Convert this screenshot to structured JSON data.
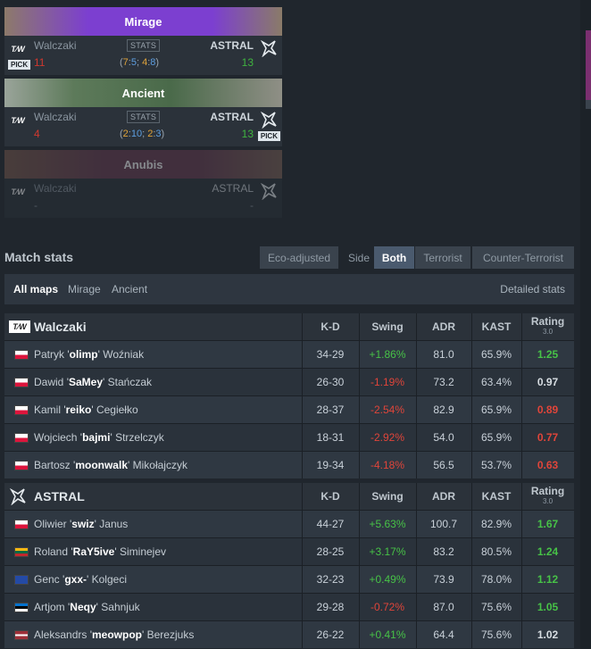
{
  "maps": [
    {
      "name": "Mirage",
      "team_left": "Walczaki",
      "team_right": "ASTRAL",
      "score_left": "11",
      "score_right": "13",
      "stats_label": "STATS",
      "half_open": "(",
      "half_t1": "7",
      "half_sep1": ":",
      "half_ct1": "5",
      "half_semi": "; ",
      "half_t2": "4",
      "half_sep2": ":",
      "half_ct2": "8",
      "half_close": ")",
      "pick_label": "PICK",
      "pick_side": "left",
      "banner_color": "#7c3fd0"
    },
    {
      "name": "Ancient",
      "team_left": "Walczaki",
      "team_right": "ASTRAL",
      "score_left": "4",
      "score_right": "13",
      "stats_label": "STATS",
      "half_open": "(",
      "half_t1": "2",
      "half_sep1": ":",
      "half_ct1": "10",
      "half_semi": "; ",
      "half_t2": "2",
      "half_sep2": ":",
      "half_ct2": "3",
      "half_close": ")",
      "pick_label": "PICK",
      "pick_side": "right",
      "banner_color": "#4f6a4e"
    },
    {
      "name": "Anubis",
      "team_left": "Walczaki",
      "team_right": "ASTRAL",
      "score_left": "-",
      "score_right": "-",
      "banner_color": "#5a3e48"
    }
  ],
  "match_stats": {
    "title": "Match stats",
    "eco_label": "Eco-adjusted",
    "side_label": "Side",
    "side_options": [
      "Both",
      "Terrorist",
      "Counter-Terrorist"
    ],
    "side_selected": "Both",
    "map_filters": [
      "All maps",
      "Mirage",
      "Ancient"
    ],
    "map_selected": "All maps",
    "detailed_label": "Detailed stats"
  },
  "columns": {
    "kd": "K-D",
    "swing": "Swing",
    "adr": "ADR",
    "kast": "KAST",
    "rating": "Rating",
    "rating_ver": "3.0"
  },
  "teams": [
    {
      "name": "Walczaki",
      "players": [
        {
          "first": "Patryk",
          "nick": "olimp",
          "last": "Woźniak",
          "flag": "pl",
          "kd": "34-29",
          "swing": "+1.86%",
          "adr": "81.0",
          "kast": "65.9%",
          "rating": "1.25"
        },
        {
          "first": "Dawid",
          "nick": "SaMey",
          "last": "Stańczak",
          "flag": "pl",
          "kd": "26-30",
          "swing": "-1.19%",
          "adr": "73.2",
          "kast": "63.4%",
          "rating": "0.97"
        },
        {
          "first": "Kamil",
          "nick": "reiko",
          "last": "Cegiełko",
          "flag": "pl",
          "kd": "28-37",
          "swing": "-2.54%",
          "adr": "82.9",
          "kast": "65.9%",
          "rating": "0.89"
        },
        {
          "first": "Wojciech",
          "nick": "bajmi",
          "last": "Strzelczyk",
          "flag": "pl",
          "kd": "18-31",
          "swing": "-2.92%",
          "adr": "54.0",
          "kast": "65.9%",
          "rating": "0.77"
        },
        {
          "first": "Bartosz",
          "nick": "moonwalk",
          "last": "Mikołajczyk",
          "flag": "pl",
          "kd": "19-34",
          "swing": "-4.18%",
          "adr": "56.5",
          "kast": "53.7%",
          "rating": "0.63"
        }
      ]
    },
    {
      "name": "ASTRAL",
      "players": [
        {
          "first": "Oliwier",
          "nick": "swiz",
          "last": "Janus",
          "flag": "pl",
          "kd": "44-27",
          "swing": "+5.63%",
          "adr": "100.7",
          "kast": "82.9%",
          "rating": "1.67"
        },
        {
          "first": "Roland",
          "nick": "RaY5ive",
          "last": "Siminejev",
          "flag": "lt",
          "kd": "28-25",
          "swing": "+3.17%",
          "adr": "83.2",
          "kast": "80.5%",
          "rating": "1.24"
        },
        {
          "first": "Genc",
          "nick": "gxx-",
          "last": "Kolgeci",
          "flag": "xk",
          "kd": "32-23",
          "swing": "+0.49%",
          "adr": "73.9",
          "kast": "78.0%",
          "rating": "1.12"
        },
        {
          "first": "Artjom",
          "nick": "Neqy",
          "last": "Sahnjuk",
          "flag": "ee",
          "kd": "29-28",
          "swing": "-0.72%",
          "adr": "87.0",
          "kast": "75.6%",
          "rating": "1.05"
        },
        {
          "first": "Aleksandrs",
          "nick": "meowpop",
          "last": "Berezjuks",
          "flag": "lv",
          "kd": "26-22",
          "swing": "+0.41%",
          "adr": "64.4",
          "kast": "75.6%",
          "rating": "1.02"
        }
      ]
    }
  ],
  "colors": {
    "positive": "#47c247",
    "negative": "#e0453a",
    "accent_selected": "#4a5a6e"
  }
}
